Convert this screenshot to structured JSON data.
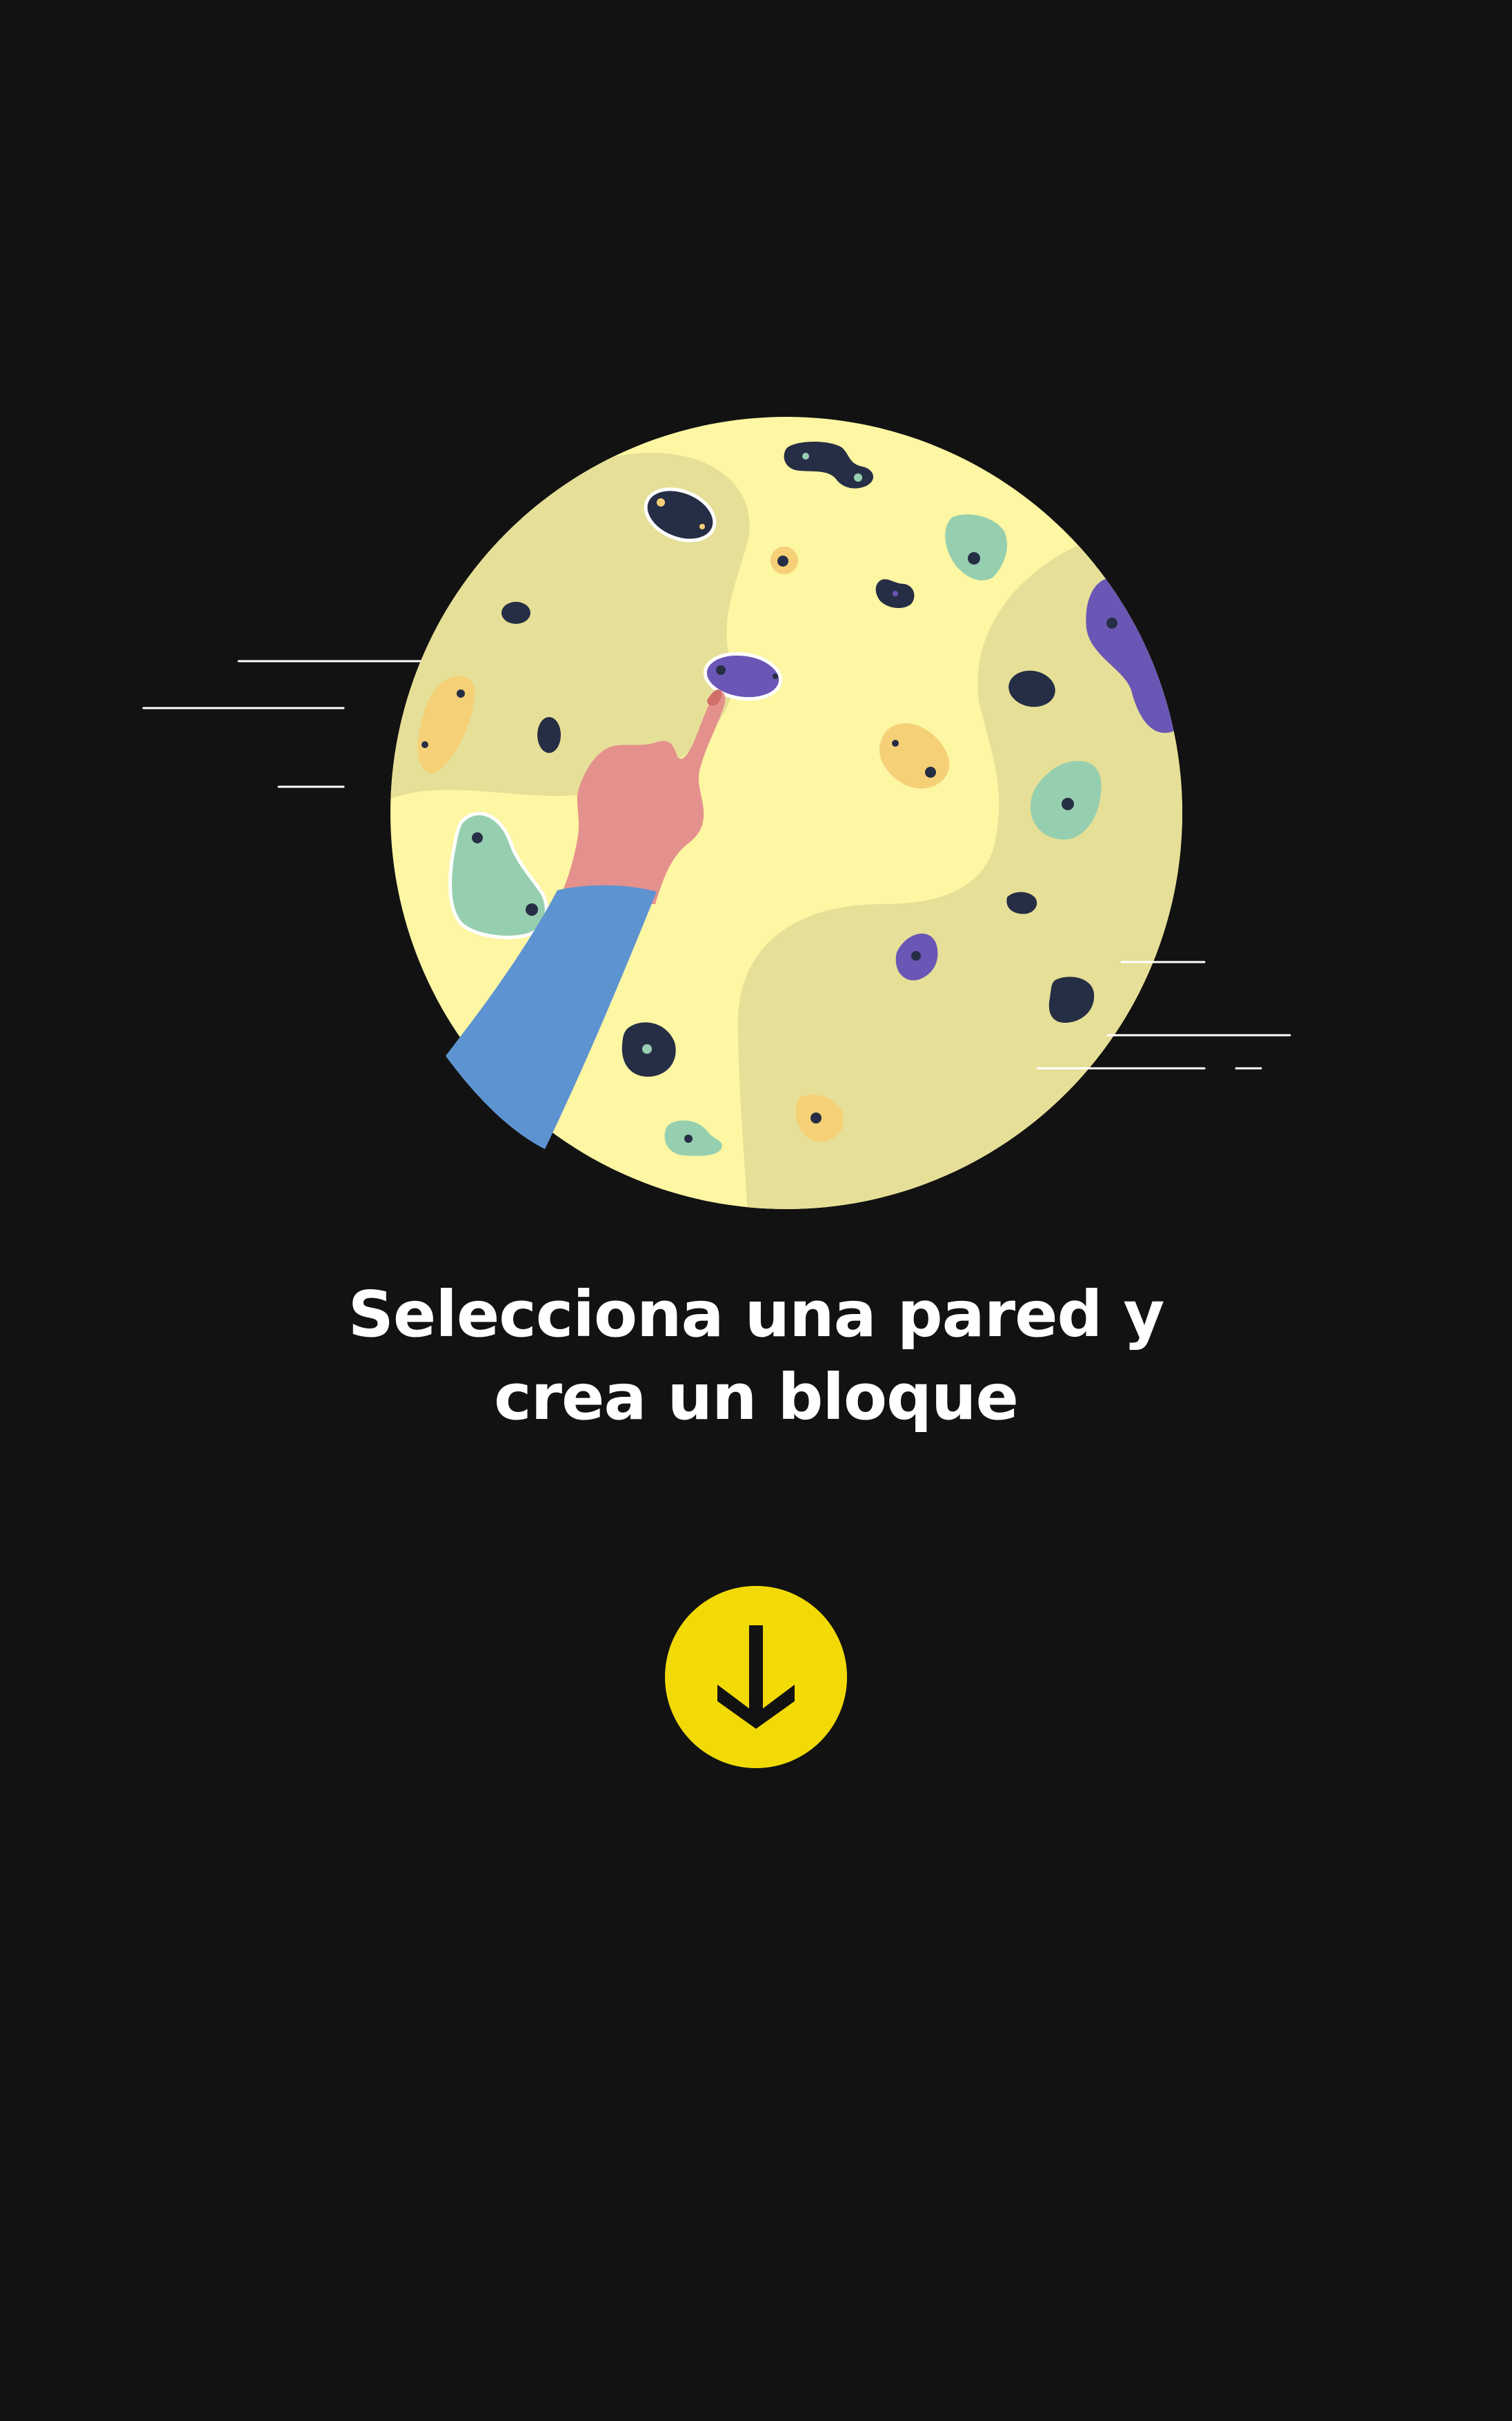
{
  "screen": {
    "background_color": "#121212",
    "accent_color": "#F2DA07"
  },
  "illustration": {
    "name": "climbing-wall-hand-illustration",
    "wall_color": "#FDF6A3",
    "wall_shade_color": "#E6DF97",
    "hold_colors": [
      "#262E45",
      "#96CFAF",
      "#F5D076",
      "#6A56B5"
    ],
    "hand_color": "#E4918D",
    "sleeve_color": "#5E93D1"
  },
  "onboarding": {
    "title_line_1": "Selecciona una pared y",
    "title_line_2": "crea un bloque"
  },
  "next_button": {
    "icon": "arrow-down-icon"
  }
}
